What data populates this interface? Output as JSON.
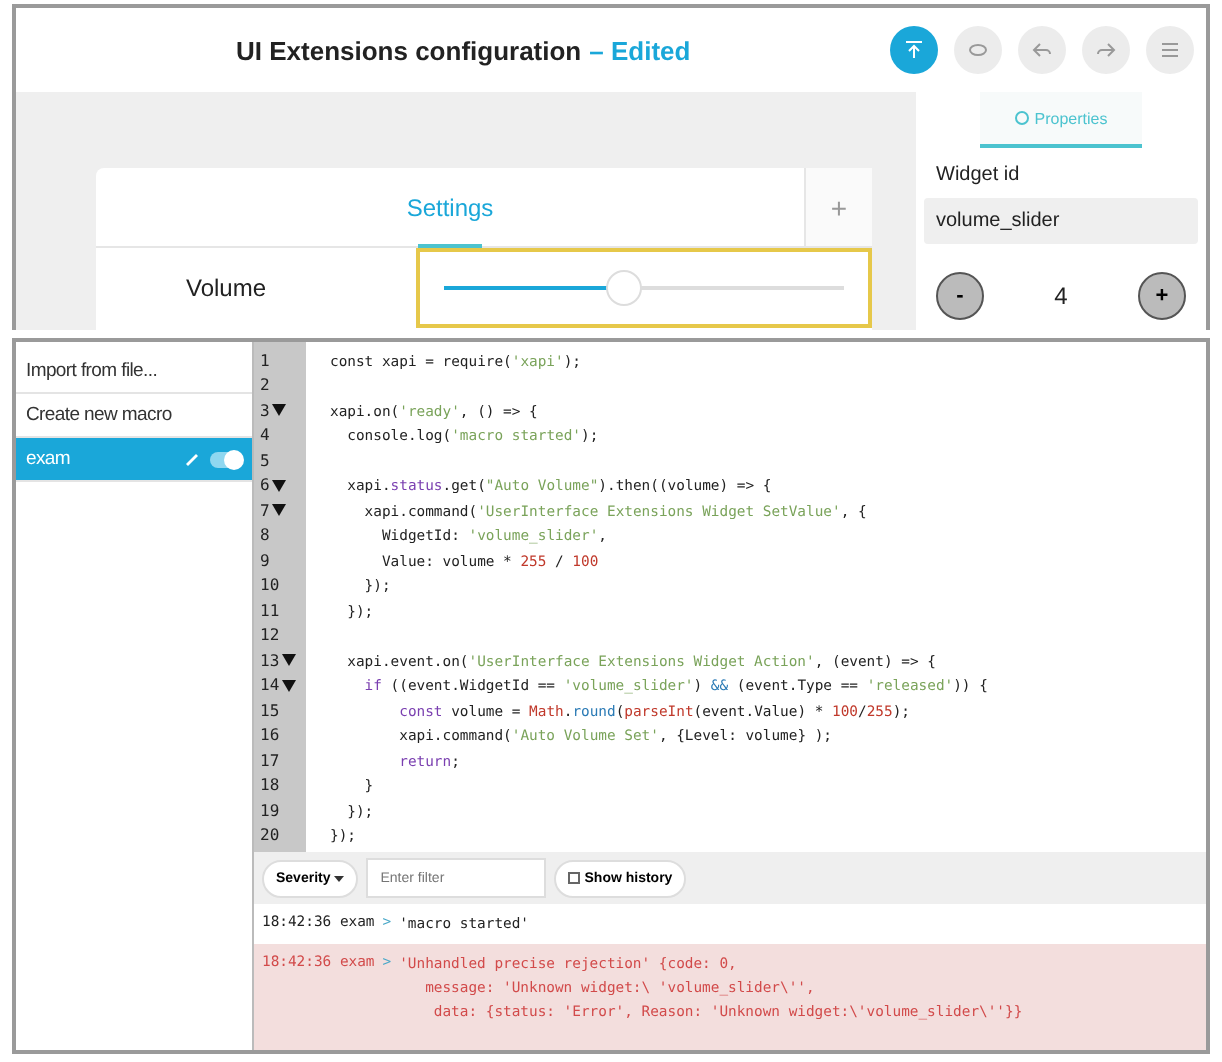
{
  "editor": {
    "title": "UI Extensions configuration",
    "status": "– Edited",
    "toolbar": [
      {
        "kind": "upload",
        "active": true
      },
      {
        "kind": "preview",
        "active": false
      },
      {
        "kind": "undo",
        "active": false
      },
      {
        "kind": "redo",
        "active": false
      },
      {
        "kind": "menu",
        "active": false
      }
    ]
  },
  "panel": {
    "tab": "Settings",
    "add": "+",
    "rows": [
      {
        "label": "Volume",
        "level": 0.45,
        "highlighted": true
      }
    ]
  },
  "properties": {
    "tab": "Properties",
    "field_label": "Widget id",
    "field_value": "volume_slider",
    "minus": "-",
    "value": "4",
    "plus": "+"
  },
  "macros": [
    {
      "label": "Import from file...",
      "selected": false
    },
    {
      "label": "Create new macro",
      "selected": false
    },
    {
      "label": "exam",
      "selected": true,
      "on": true
    }
  ],
  "code": [
    {
      "n": "1",
      "fold": false,
      "tokens": [
        {
          "kind": "plain",
          "t": "const xapi = require("
        },
        {
          "kind": "str",
          "t": "'xapi'"
        },
        {
          "kind": "plain",
          "t": ");"
        }
      ]
    },
    {
      "n": "2",
      "fold": false
    },
    {
      "n": "3",
      "fold": true,
      "tokens": [
        {
          "kind": "plain",
          "t": "xapi.on("
        },
        {
          "kind": "str",
          "t": "'ready'"
        },
        {
          "kind": "plain",
          "t": ", () => {"
        }
      ]
    },
    {
      "n": "4",
      "fold": false,
      "tokens": [
        {
          "kind": "plain",
          "t": "  console.log("
        },
        {
          "kind": "str",
          "t": "'macro started'"
        },
        {
          "kind": "plain",
          "t": ");"
        }
      ]
    },
    {
      "n": "5",
      "fold": false
    },
    {
      "n": "6",
      "fold": true,
      "tokens": [
        {
          "kind": "plain",
          "t": "  xapi."
        },
        {
          "kind": "kw",
          "t": "status"
        },
        {
          "kind": "plain",
          "t": ".get("
        },
        {
          "kind": "str",
          "t": "\"Auto Volume\""
        },
        {
          "kind": "plain",
          "t": ").then((volume) => {"
        }
      ]
    },
    {
      "n": "7",
      "fold": true,
      "tokens": [
        {
          "kind": "plain",
          "t": "    xapi.command("
        },
        {
          "kind": "str",
          "t": "'UserInterface Extensions Widget SetValue'"
        },
        {
          "kind": "plain",
          "t": ", {"
        }
      ]
    },
    {
      "n": "8",
      "fold": false,
      "tokens": [
        {
          "kind": "plain",
          "t": "      WidgetId: "
        },
        {
          "kind": "str",
          "t": "'volume_slider'"
        },
        {
          "kind": "plain",
          "t": ","
        }
      ]
    },
    {
      "n": "9",
      "fold": false,
      "tokens": [
        {
          "kind": "plain",
          "t": "      Value: volume * "
        },
        {
          "kind": "num",
          "t": "255"
        },
        {
          "kind": "plain",
          "t": " / "
        },
        {
          "kind": "num",
          "t": "100"
        }
      ]
    },
    {
      "n": "10",
      "fold": false,
      "tokens": [
        {
          "kind": "plain",
          "t": "    });"
        }
      ]
    },
    {
      "n": "11",
      "fold": false,
      "tokens": [
        {
          "kind": "plain",
          "t": "  });"
        }
      ]
    },
    {
      "n": "12",
      "fold": false
    },
    {
      "n": "13",
      "fold": true,
      "tokens": [
        {
          "kind": "plain",
          "t": "  xapi.event.on("
        },
        {
          "kind": "str",
          "t": "'UserInterface Extensions Widget Action'"
        },
        {
          "kind": "plain",
          "t": ", (event) => {"
        }
      ]
    },
    {
      "n": "14",
      "fold": true,
      "tokens": [
        {
          "kind": "kw",
          "t": "    if"
        },
        {
          "kind": "plain",
          "t": " ((event.WidgetId == "
        },
        {
          "kind": "str",
          "t": "'volume_slider'"
        },
        {
          "kind": "plain",
          "t": ") "
        },
        {
          "kind": "call",
          "t": "&&"
        },
        {
          "kind": "plain",
          "t": " (event.Type == "
        },
        {
          "kind": "str",
          "t": "'released'"
        },
        {
          "kind": "plain",
          "t": ")) {"
        }
      ]
    },
    {
      "n": "15",
      "fold": false,
      "tokens": [
        {
          "kind": "kw",
          "t": "        const"
        },
        {
          "kind": "plain",
          "t": " volume = "
        },
        {
          "kind": "num",
          "t": "Math"
        },
        {
          "kind": "plain",
          "t": "."
        },
        {
          "kind": "call",
          "t": "round"
        },
        {
          "kind": "plain",
          "t": "("
        },
        {
          "kind": "num",
          "t": "parseInt"
        },
        {
          "kind": "plain",
          "t": "(event.Value) * "
        },
        {
          "kind": "num",
          "t": "100"
        },
        {
          "kind": "plain",
          "t": "/"
        },
        {
          "kind": "num",
          "t": "255"
        },
        {
          "kind": "plain",
          "t": ");"
        }
      ]
    },
    {
      "n": "16",
      "fold": false,
      "tokens": [
        {
          "kind": "plain",
          "t": "        xapi.command("
        },
        {
          "kind": "str",
          "t": "'Auto Volume Set'"
        },
        {
          "kind": "plain",
          "t": ", {Level: volume} );"
        }
      ]
    },
    {
      "n": "17",
      "fold": false,
      "tokens": [
        {
          "kind": "kw",
          "t": "        return"
        },
        {
          "kind": "plain",
          "t": ";"
        }
      ]
    },
    {
      "n": "18",
      "fold": false,
      "tokens": [
        {
          "kind": "plain",
          "t": "    }"
        }
      ]
    },
    {
      "n": "19",
      "fold": false,
      "tokens": [
        {
          "kind": "plain",
          "t": "  });"
        }
      ]
    },
    {
      "n": "20",
      "fold": false,
      "tokens": [
        {
          "kind": "plain",
          "t": "});"
        }
      ]
    }
  ],
  "console": {
    "severity": "Severity",
    "filter": {
      "placeholder": "Enter filter"
    },
    "history": {
      "label": "Show history",
      "checked": false
    },
    "logs": [
      {
        "kind": "info",
        "time": "18:42:36",
        "macro": "exam",
        "sep": ">",
        "lines": [
          "'macro started'"
        ]
      },
      {
        "kind": "error",
        "time": "18:42:36",
        "macro": "exam",
        "sep": ">",
        "lines": [
          "'Unhandled precise rejection' {code: 0,",
          "   message: 'Unknown widget:\\ 'volume_slider\\'',",
          "    data: {status: 'Error', Reason: 'Unknown widget:\\'volume_slider\\''}}"
        ]
      }
    ]
  }
}
